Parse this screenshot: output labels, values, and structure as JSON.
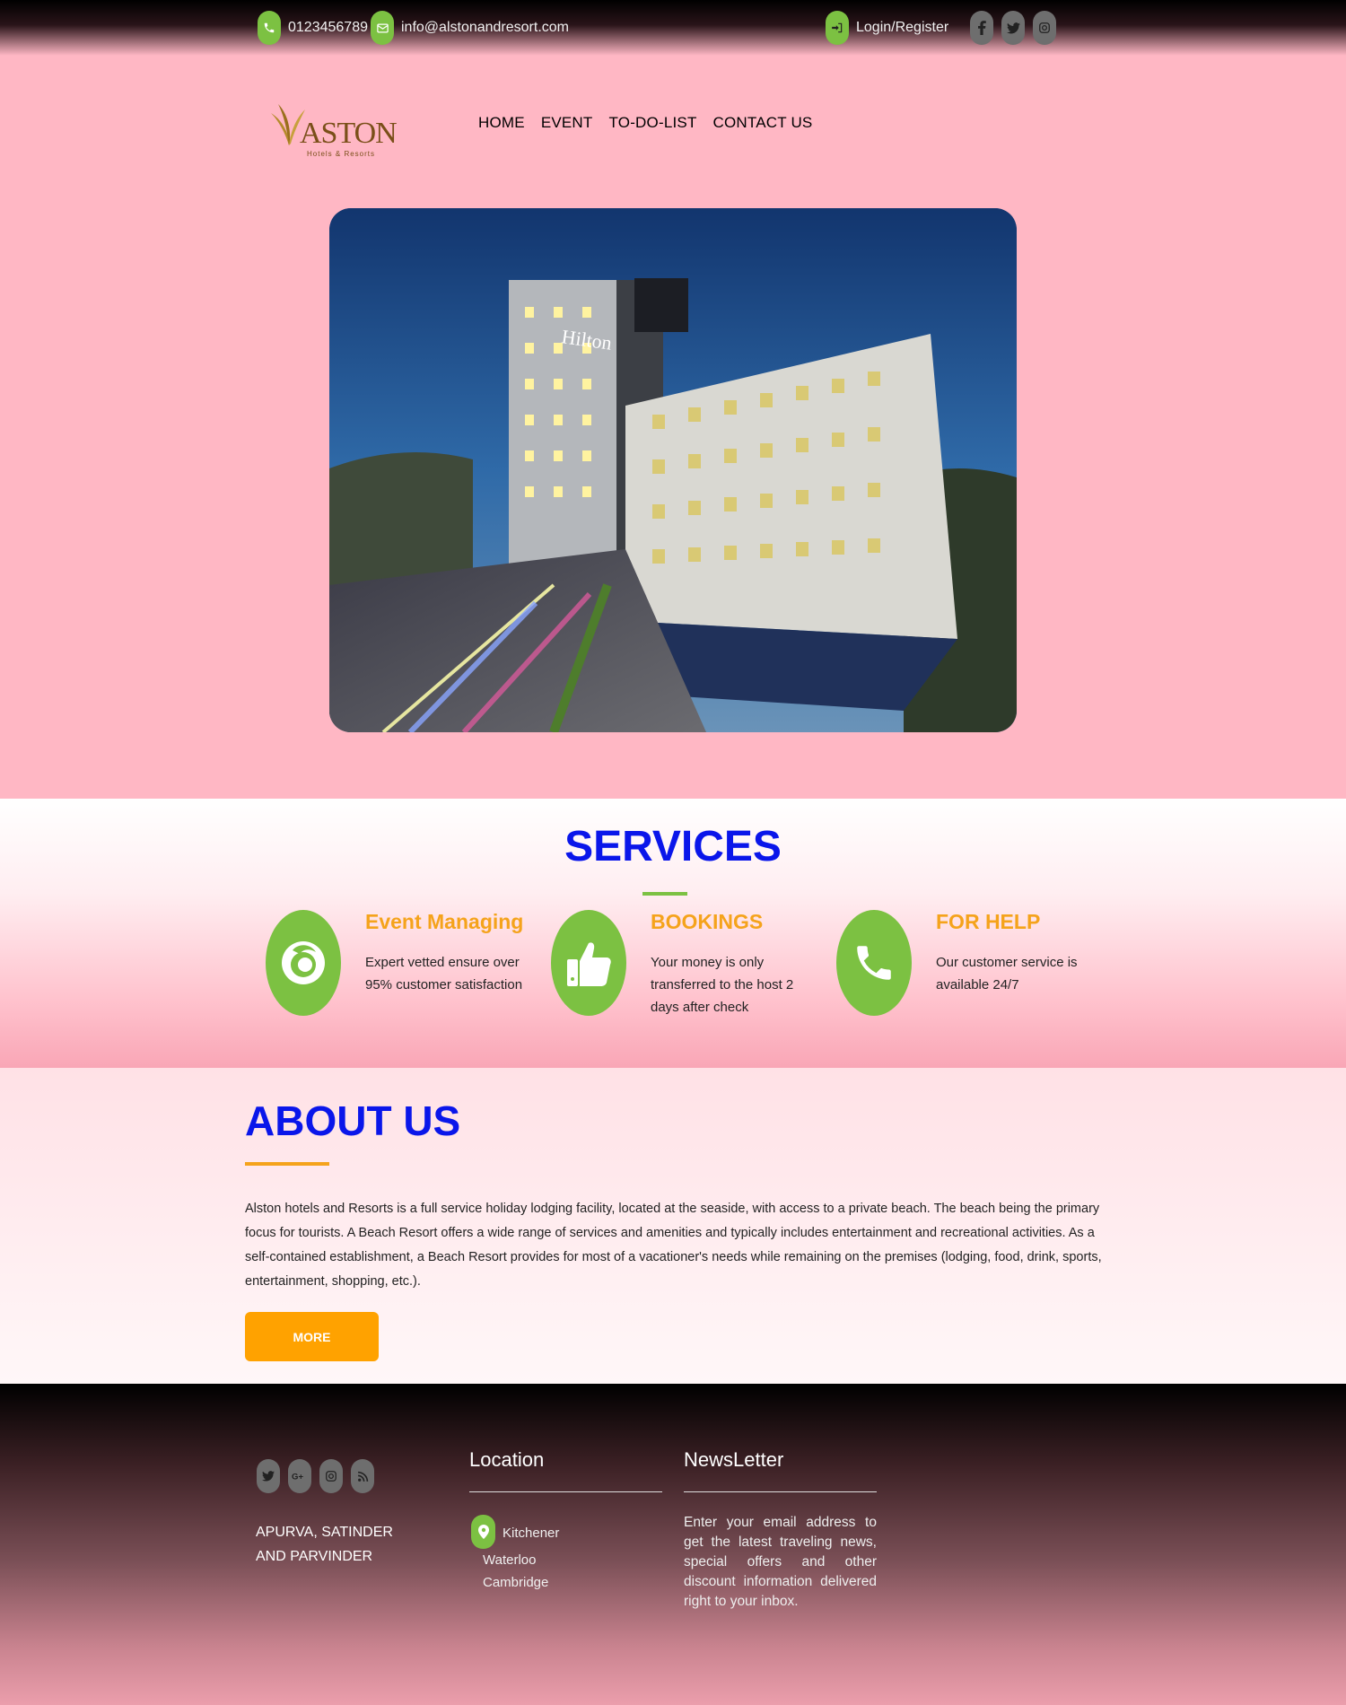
{
  "topbar": {
    "phone": "0123456789",
    "email": "info@alstonandresort.com",
    "login": "Login/Register",
    "social_icons": [
      "facebook-icon",
      "twitter-icon",
      "instagram-icon"
    ]
  },
  "brand": {
    "logo_text": "ASTON",
    "logo_sub": "Hotels & Resorts"
  },
  "nav": {
    "items": [
      "HOME",
      "EVENT",
      "TO-DO-LIST",
      "CONTACT US"
    ]
  },
  "hero": {
    "sign_text": "Hilton"
  },
  "services": {
    "title": "SERVICES",
    "items": [
      {
        "title": "Event Managing",
        "text": "Expert vetted ensure over 95% customer satisfaction",
        "icon": "firefox-icon"
      },
      {
        "title": "BOOKINGS",
        "text": "Your money is only transferred to the host 2 days after check",
        "icon": "thumbs-up-icon"
      },
      {
        "title": "FOR HELP",
        "text": "Our customer service is available 24/7",
        "icon": "phone-icon"
      }
    ]
  },
  "about": {
    "title": "ABOUT US",
    "text": "Alston hotels and Resorts is a full service holiday lodging facility, located at the seaside, with access to a private beach. The beach being the primary focus for tourists. A Beach Resort offers a wide range of services and amenities and typically includes entertainment and recreational activities. As a self-contained establishment, a Beach Resort provides for most of a vacationer's needs while remaining on the premises (lodging, food, drink, sports, entertainment, shopping, etc.).",
    "button": "MORE"
  },
  "footer": {
    "social_icons": [
      "twitter-icon",
      "google-plus-icon",
      "instagram-icon",
      "rss-icon"
    ],
    "names": "APURVA, SATINDER AND PARVINDER",
    "location_title": "Location",
    "locations": [
      "Kitchener",
      "Waterloo",
      "Cambridge"
    ],
    "newsletter_title": "NewsLetter",
    "newsletter_text": "Enter your email address to get the latest traveling news, special offers and other discount information delivered right to your inbox."
  },
  "colors": {
    "page_bg": "#ffb7c4",
    "accent_green": "#7cc142",
    "heading_blue": "#0a16ea",
    "accent_orange": "#f5a31b",
    "button_orange": "#ffa200"
  }
}
